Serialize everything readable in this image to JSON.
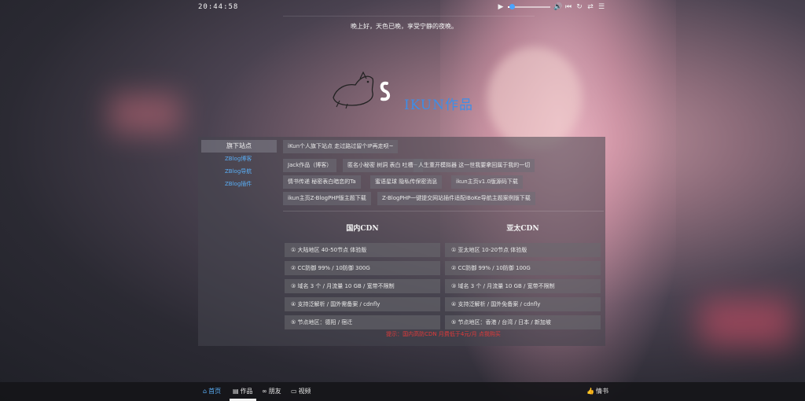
{
  "topbar": {
    "clock": "20:44:58",
    "greeting": "晚上好，天色已晚，享受宁静的夜晚。",
    "player": {
      "play_icon": "play-icon",
      "progress": 0.1,
      "volume_icon": "volume-icon",
      "prev_icon": "prev-icon",
      "loop_icon": "loop-icon",
      "shuffle_icon": "shuffle-icon",
      "playlist_icon": "playlist-icon"
    }
  },
  "site": {
    "title": "IKUN作品",
    "accent": "#3d8ee8"
  },
  "sidebar": {
    "heading": "旗下站点",
    "items": [
      {
        "label": "ZBlog博客"
      },
      {
        "label": "ZBlog导航"
      },
      {
        "label": "ZBlog插件"
      }
    ]
  },
  "links": [
    {
      "label": "iKun个人旗下站点 走过路过留个IP再走呗~"
    },
    {
      "label": "Jack作品（博客）"
    },
    {
      "label": "匿名小秘密 树洞 表白 吐槽~"
    },
    {
      "label": "人生重开模拟器 这一世我要拿回属于我的一切"
    },
    {
      "label": "情书传递 秘密表白暗恋的Ta"
    },
    {
      "label": "蜜语星球 隐私传保密消息"
    },
    {
      "label": "ikun主页v1.0版源码下载"
    },
    {
      "label": "ikun主页Z-BlogPHP版主题下载"
    },
    {
      "label": "Z-BlogPHP一键提交网站插件适配iBoKe导航主题案例版下载"
    }
  ],
  "cdn_domestic": {
    "title": "国内CDN",
    "rows": [
      {
        "label": "① 大陆地区 40-50节点 体验版"
      },
      {
        "label": "② CC防御 99% / 10防御 300G"
      },
      {
        "label": "③ 域名 3 个 / 月流量 10 GB / 宽带不限制"
      },
      {
        "label": "④ 支持泛解析 / 国外需备案 / cdnfly"
      },
      {
        "label": "⑤ 节点地区：德阳 / 宿迁"
      }
    ]
  },
  "cdn_apac": {
    "title": "亚太CDN",
    "rows": [
      {
        "label": "① 亚太地区 10-20节点 体验版"
      },
      {
        "label": "② CC防御 99% / 10防御 100G"
      },
      {
        "label": "③ 域名 3 个 / 月流量 10 GB / 宽带不限制"
      },
      {
        "label": "④ 支持泛解析 / 国外免备案 / cdnfly"
      },
      {
        "label": "⑤ 节点地区：香港 / 台湾 / 日本 / 新加坡"
      }
    ]
  },
  "notice": "提示：国内高防CDN 月费低于4元/月 点我购买",
  "footer": {
    "nav": [
      {
        "label": "首页",
        "icon": "home-icon",
        "active": true
      },
      {
        "label": "作品",
        "icon": "works-icon",
        "active": false
      },
      {
        "label": "朋友",
        "icon": "link-icon",
        "active": false
      },
      {
        "label": "视频",
        "icon": "video-icon",
        "active": false
      }
    ],
    "right": {
      "label": "情书",
      "icon": "thumb-icon"
    }
  },
  "colors": {
    "link_blue": "#5aaef5",
    "notice_red": "#e03a3a"
  }
}
